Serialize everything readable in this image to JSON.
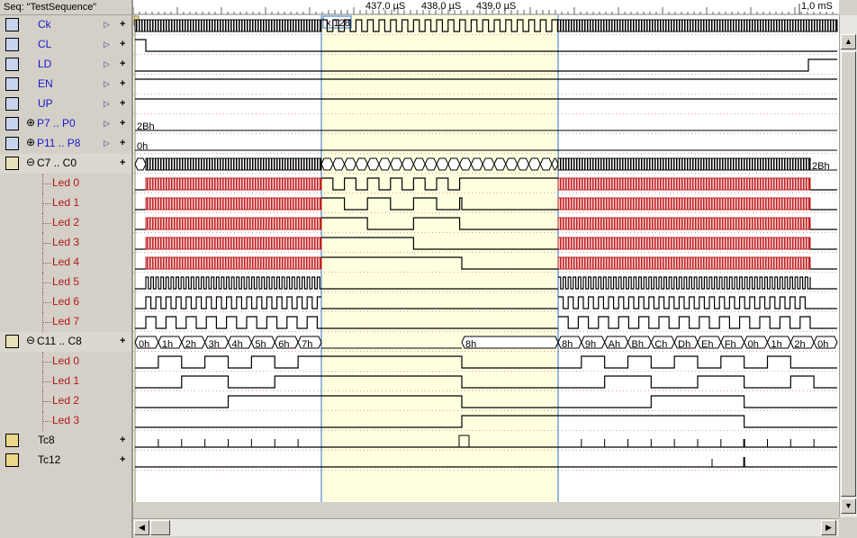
{
  "window": {
    "title": "Seq: \"TestSequence\""
  },
  "ruler": {
    "labels": [
      "437,0 µS",
      "438,0 µS",
      "439,0 µS",
      "1,0 mS"
    ],
    "zoom_label": "x 128"
  },
  "signals": [
    {
      "name": "Ck",
      "kind": "clock",
      "color": "blue",
      "icon": "clock-icon",
      "expander": ""
    },
    {
      "name": "CL",
      "kind": "input",
      "color": "blue",
      "icon": "input-icon",
      "expander": ""
    },
    {
      "name": "LD",
      "kind": "input",
      "color": "blue",
      "icon": "input-icon",
      "expander": ""
    },
    {
      "name": "EN",
      "kind": "input",
      "color": "blue",
      "icon": "input-icon",
      "expander": ""
    },
    {
      "name": "UP",
      "kind": "input",
      "color": "blue",
      "icon": "input-icon",
      "expander": ""
    },
    {
      "name": "P7 .. P0",
      "kind": "bus-in",
      "color": "blue",
      "icon": "bus-input-icon",
      "expander": "⊕"
    },
    {
      "name": "P11 .. P8",
      "kind": "bus-in",
      "color": "blue",
      "icon": "bus-input-icon",
      "expander": "⊕"
    },
    {
      "name": "C7 .. C0",
      "kind": "bus-out",
      "color": "black",
      "icon": "counter-icon",
      "expander": "⊖"
    },
    {
      "name": "Led 0",
      "kind": "led",
      "color": "red"
    },
    {
      "name": "Led 1",
      "kind": "led",
      "color": "red"
    },
    {
      "name": "Led 2",
      "kind": "led",
      "color": "red"
    },
    {
      "name": "Led 3",
      "kind": "led",
      "color": "red"
    },
    {
      "name": "Led 4",
      "kind": "led",
      "color": "red"
    },
    {
      "name": "Led 5",
      "kind": "led",
      "color": "red"
    },
    {
      "name": "Led 6",
      "kind": "led",
      "color": "red"
    },
    {
      "name": "Led 7",
      "kind": "led",
      "color": "red"
    },
    {
      "name": "C11 .. C8",
      "kind": "bus-out",
      "color": "black",
      "icon": "counter-icon",
      "expander": "⊖"
    },
    {
      "name": "Led 0",
      "kind": "led",
      "color": "red"
    },
    {
      "name": "Led 1",
      "kind": "led",
      "color": "red"
    },
    {
      "name": "Led 2",
      "kind": "led",
      "color": "red"
    },
    {
      "name": "Led 3",
      "kind": "led",
      "color": "red"
    },
    {
      "name": "Tc8",
      "kind": "tc",
      "color": "black",
      "icon": "terminal-count-icon",
      "expander": ""
    },
    {
      "name": "Tc12",
      "kind": "tc",
      "color": "black",
      "icon": "terminal-count-icon",
      "expander": ""
    }
  ],
  "waves": {
    "p_lo_value": "2Bh",
    "p_hi_value": "0h",
    "c_lo_end_value": "2Bh",
    "c_hi_values_left": [
      "0h",
      "1h",
      "2h",
      "3h",
      "4h",
      "5h",
      "6h",
      "7h"
    ],
    "c_hi_value_mid": "8h",
    "c_hi_values_right": [
      "8h",
      "9h",
      "Ah",
      "Bh",
      "Ch",
      "Dh",
      "Eh",
      "Fh",
      "0h",
      "1h",
      "2h",
      "0h"
    ]
  },
  "colors": {
    "highlight": "#ffffe0",
    "cursor": "#3070c8",
    "dense_red": "#c02020",
    "led_label": "#b01818",
    "signal_label": "#1a1acc"
  },
  "scrollbars": {
    "up_arrow": "▲",
    "down_arrow": "▼",
    "left_arrow": "◀",
    "right_arrow": "▶"
  }
}
